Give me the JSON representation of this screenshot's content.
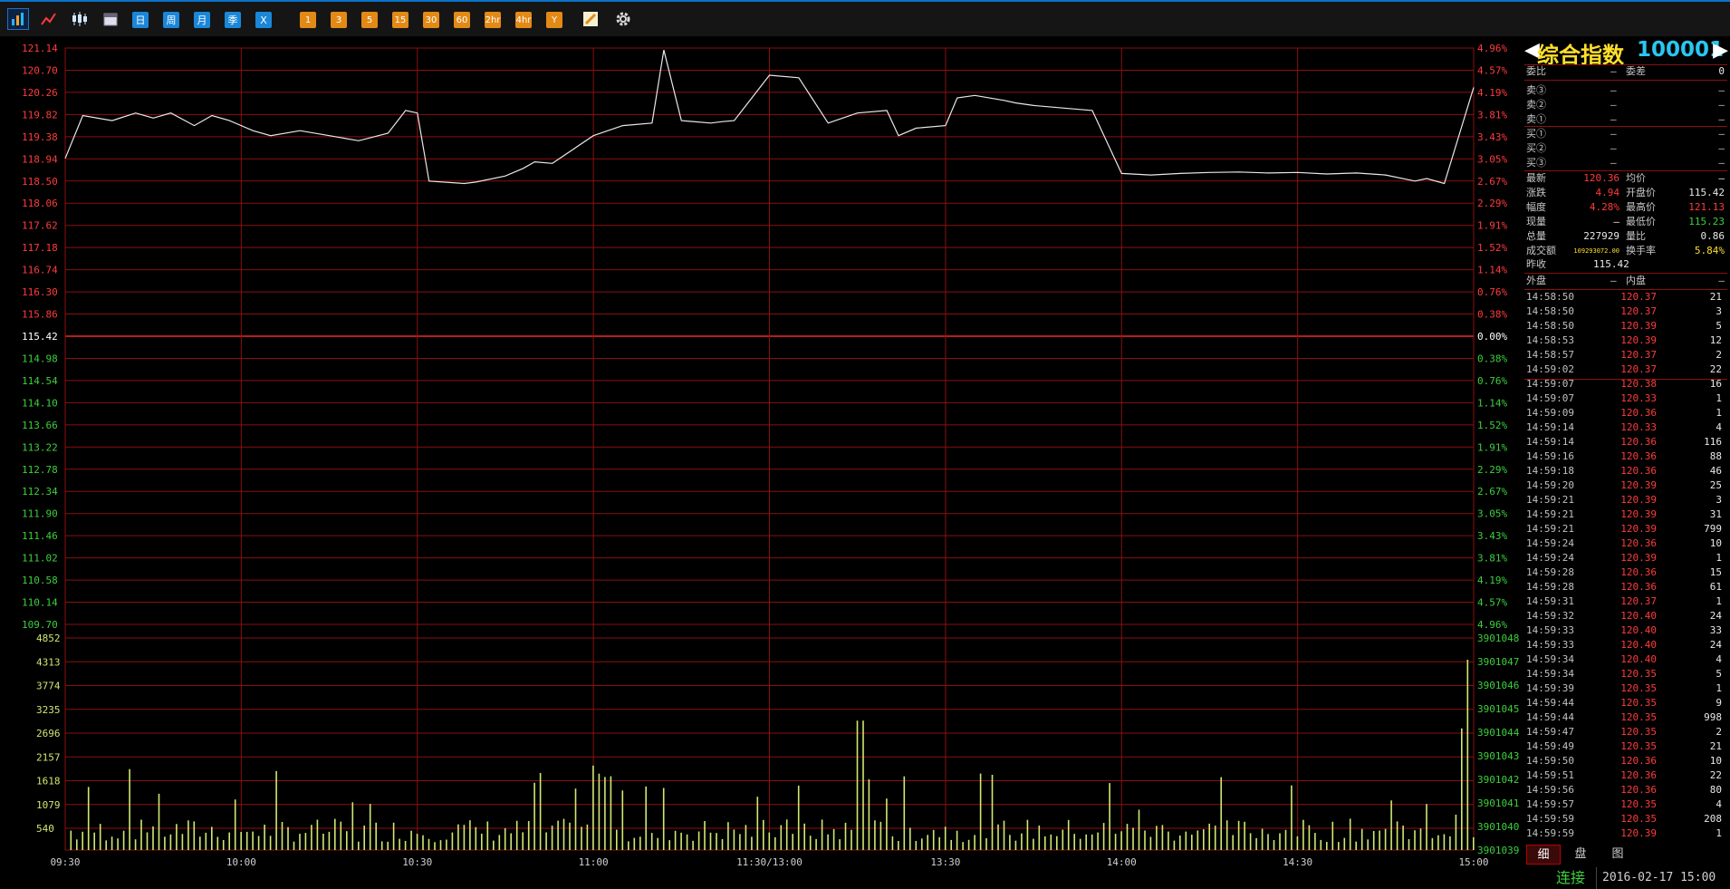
{
  "toolbar": {
    "buttons": [
      {
        "name": "intraday-chart-icon",
        "type": "icon",
        "selected": true
      },
      {
        "name": "line-chart-icon",
        "type": "icon"
      },
      {
        "name": "candlestick-icon",
        "type": "icon"
      },
      {
        "name": "calendar-icon",
        "type": "icon"
      },
      {
        "name": "period-day-button",
        "type": "blue",
        "label": "日"
      },
      {
        "name": "period-week-button",
        "type": "blue",
        "label": "周"
      },
      {
        "name": "period-month-button",
        "type": "blue",
        "label": "月"
      },
      {
        "name": "period-quarter-button",
        "type": "blue",
        "label": "季"
      },
      {
        "name": "period-x-button",
        "type": "blue",
        "label": "X"
      },
      {
        "name": "period-1min-button",
        "type": "orange",
        "label": "1"
      },
      {
        "name": "period-3min-button",
        "type": "orange",
        "label": "3"
      },
      {
        "name": "period-5min-button",
        "type": "orange",
        "label": "5"
      },
      {
        "name": "period-15min-button",
        "type": "orange",
        "label": "15"
      },
      {
        "name": "period-30min-button",
        "type": "orange",
        "label": "30"
      },
      {
        "name": "period-60min-button",
        "type": "orange",
        "label": "60"
      },
      {
        "name": "period-2hr-button",
        "type": "orange",
        "label": "2hr"
      },
      {
        "name": "period-4hr-button",
        "type": "orange",
        "label": "4hr"
      },
      {
        "name": "period-year-button",
        "type": "orange",
        "label": "Y"
      },
      {
        "name": "draw-tool-icon",
        "type": "icon"
      },
      {
        "name": "gear-icon",
        "type": "icon"
      }
    ]
  },
  "colors": {
    "up": "#ff3b3b",
    "down": "#3cd03c",
    "grid": "#8a1010",
    "line": "#e8e8e8",
    "volume": "#cfe870",
    "yellow": "#ffdf2a",
    "cyan": "#29c7f0"
  },
  "chart_data": {
    "type": "line",
    "price": {
      "prev_close": 115.42,
      "ylim": [
        109.7,
        121.14
      ],
      "y_ticks_left": [
        "121.14",
        "120.70",
        "120.26",
        "119.82",
        "119.38",
        "118.94",
        "118.50",
        "118.06",
        "117.62",
        "117.18",
        "116.74",
        "116.30",
        "115.86",
        "115.42",
        "114.98",
        "114.54",
        "114.10",
        "113.66",
        "113.22",
        "112.78",
        "112.34",
        "111.90",
        "111.46",
        "111.02",
        "110.58",
        "110.14",
        "109.70"
      ],
      "y_ticks_right": [
        "4.96%",
        "4.57%",
        "4.19%",
        "3.81%",
        "3.43%",
        "3.05%",
        "2.67%",
        "2.29%",
        "1.91%",
        "1.52%",
        "1.14%",
        "0.76%",
        "0.38%",
        "0.00%",
        "0.38%",
        "0.76%",
        "1.14%",
        "1.52%",
        "1.91%",
        "2.29%",
        "2.67%",
        "3.05%",
        "3.43%",
        "3.81%",
        "4.19%",
        "4.57%",
        "4.96%"
      ],
      "x_ticks": [
        "09:30",
        "10:00",
        "10:30",
        "11:00",
        "11:30/13:00",
        "13:30",
        "14:00",
        "14:30",
        "15:00"
      ],
      "x_minutes": [
        0,
        3,
        8,
        12,
        15,
        18,
        22,
        25,
        28,
        32,
        35,
        40,
        45,
        50,
        55,
        58,
        60,
        62,
        68,
        70,
        75,
        78,
        80,
        83,
        90,
        95,
        100,
        102,
        105,
        110,
        112,
        114,
        120,
        125,
        130,
        135,
        140,
        142,
        145,
        150,
        152,
        155,
        160,
        162,
        165,
        170,
        175,
        180,
        185,
        190,
        195,
        200,
        205,
        210,
        215,
        220,
        225,
        230,
        232,
        235,
        240
      ],
      "values": [
        118.95,
        119.8,
        119.7,
        119.85,
        119.75,
        119.85,
        119.6,
        119.8,
        119.7,
        119.5,
        119.4,
        119.5,
        119.4,
        119.3,
        119.45,
        119.9,
        119.85,
        118.5,
        118.45,
        118.48,
        118.6,
        118.75,
        118.88,
        118.85,
        119.4,
        119.6,
        119.65,
        121.1,
        119.7,
        119.65,
        119.68,
        119.7,
        120.6,
        120.55,
        119.65,
        119.85,
        119.9,
        119.4,
        119.55,
        119.6,
        120.15,
        120.2,
        120.1,
        120.05,
        120.0,
        119.95,
        119.9,
        118.65,
        118.62,
        118.65,
        118.67,
        118.68,
        118.66,
        118.67,
        118.64,
        118.66,
        118.62,
        118.5,
        118.55,
        118.45,
        120.36
      ]
    },
    "volume": {
      "ylim": [
        0,
        4852
      ],
      "y_ticks_left": [
        "4852",
        "4313",
        "3774",
        "3235",
        "2696",
        "2157",
        "1618",
        "1079",
        "540"
      ],
      "y_ticks_right": [
        "3901048",
        "3901047",
        "3901046",
        "3901045",
        "3901044",
        "3901043",
        "3901042",
        "3901041",
        "3901040",
        "3901039"
      ]
    },
    "grid": true
  },
  "panel": {
    "title_name": "综合指数",
    "title_code": "100001",
    "weibi_label": "委比",
    "weibi_value": "—",
    "weicha_label": "委差",
    "weicha_value": "0",
    "asks": [
      {
        "label": "卖③",
        "price": "—",
        "vol": "—"
      },
      {
        "label": "卖②",
        "price": "—",
        "vol": "—"
      },
      {
        "label": "卖①",
        "price": "—",
        "vol": "—"
      }
    ],
    "bids": [
      {
        "label": "买①",
        "price": "—",
        "vol": "—"
      },
      {
        "label": "买②",
        "price": "—",
        "vol": "—"
      },
      {
        "label": "买③",
        "price": "—",
        "vol": "—"
      }
    ],
    "quote": [
      {
        "l1": "最新",
        "v1": "120.36",
        "c1": "up",
        "l2": "均价",
        "v2": "—",
        "c2": "white"
      },
      {
        "l1": "涨跌",
        "v1": "4.94",
        "c1": "up",
        "l2": "开盘价",
        "v2": "115.42",
        "c2": "white"
      },
      {
        "l1": "幅度",
        "v1": "4.28%",
        "c1": "up",
        "l2": "最高价",
        "v2": "121.13",
        "c2": "up"
      },
      {
        "l1": "现量",
        "v1": "—",
        "c1": "white",
        "l2": "最低价",
        "v2": "115.23",
        "c2": "down"
      },
      {
        "l1": "总量",
        "v1": "227929",
        "c1": "white",
        "l2": "量比",
        "v2": "0.86",
        "c2": "white"
      },
      {
        "l1": "成交额",
        "v1": "109293072.00",
        "c1": "yellow",
        "l2": "换手率",
        "v2": "5.84%",
        "c2": "yellow"
      }
    ],
    "prev_close_label": "昨收",
    "prev_close_value": "115.42",
    "outer_label": "外盘",
    "outer_value": "—",
    "inner_label": "内盘",
    "inner_value": "—",
    "ticks": [
      [
        "14:58:50",
        "120.37",
        "21"
      ],
      [
        "14:58:50",
        "120.37",
        "3"
      ],
      [
        "14:58:50",
        "120.39",
        "5"
      ],
      [
        "14:58:53",
        "120.39",
        "12"
      ],
      [
        "14:58:57",
        "120.37",
        "2"
      ],
      [
        "14:59:02",
        "120.37",
        "22"
      ],
      [
        "14:59:07",
        "120.38",
        "16"
      ],
      [
        "14:59:07",
        "120.33",
        "1"
      ],
      [
        "14:59:09",
        "120.36",
        "1"
      ],
      [
        "14:59:14",
        "120.33",
        "4"
      ],
      [
        "14:59:14",
        "120.36",
        "116"
      ],
      [
        "14:59:16",
        "120.36",
        "88"
      ],
      [
        "14:59:18",
        "120.36",
        "46"
      ],
      [
        "14:59:20",
        "120.39",
        "25"
      ],
      [
        "14:59:21",
        "120.39",
        "3"
      ],
      [
        "14:59:21",
        "120.39",
        "31"
      ],
      [
        "14:59:21",
        "120.39",
        "799"
      ],
      [
        "14:59:24",
        "120.36",
        "10"
      ],
      [
        "14:59:24",
        "120.39",
        "1"
      ],
      [
        "14:59:28",
        "120.36",
        "15"
      ],
      [
        "14:59:28",
        "120.36",
        "61"
      ],
      [
        "14:59:31",
        "120.37",
        "1"
      ],
      [
        "14:59:32",
        "120.40",
        "24"
      ],
      [
        "14:59:33",
        "120.40",
        "33"
      ],
      [
        "14:59:33",
        "120.40",
        "24"
      ],
      [
        "14:59:34",
        "120.40",
        "4"
      ],
      [
        "14:59:34",
        "120.35",
        "5"
      ],
      [
        "14:59:39",
        "120.35",
        "1"
      ],
      [
        "14:59:44",
        "120.35",
        "9"
      ],
      [
        "14:59:44",
        "120.35",
        "998"
      ],
      [
        "14:59:47",
        "120.35",
        "2"
      ],
      [
        "14:59:49",
        "120.35",
        "21"
      ],
      [
        "14:59:50",
        "120.36",
        "10"
      ],
      [
        "14:59:51",
        "120.36",
        "22"
      ],
      [
        "14:59:56",
        "120.36",
        "80"
      ],
      [
        "14:59:57",
        "120.35",
        "4"
      ],
      [
        "14:59:59",
        "120.35",
        "208"
      ],
      [
        "14:59:59",
        "120.39",
        "1"
      ]
    ]
  },
  "bottom_tabs": [
    {
      "label": "细",
      "active": true
    },
    {
      "label": "盘",
      "active": false
    },
    {
      "label": "图",
      "active": false
    }
  ],
  "status": {
    "connection": "连接",
    "datetime": "2016-02-17 15:00"
  }
}
